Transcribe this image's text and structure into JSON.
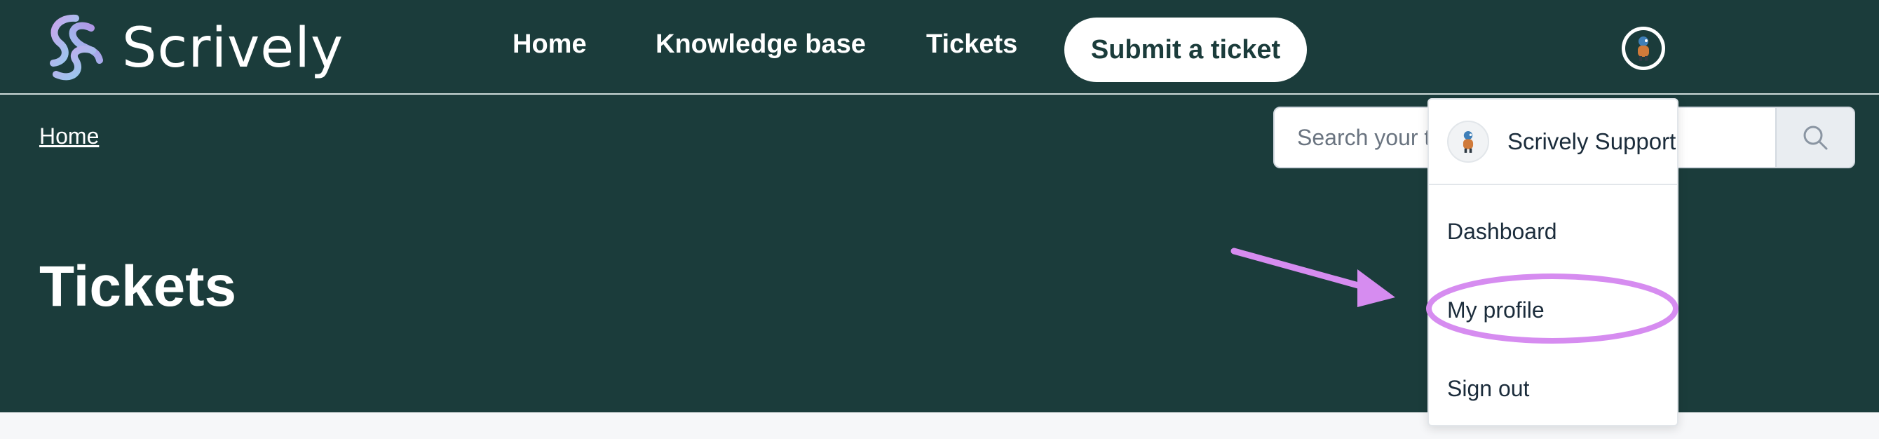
{
  "brand": {
    "name": "Scrively"
  },
  "nav": {
    "home": "Home",
    "knowledge_base": "Knowledge base",
    "tickets": "Tickets",
    "submit_ticket": "Submit a ticket"
  },
  "breadcrumb": {
    "home": "Home"
  },
  "search": {
    "placeholder": "Search your tickets"
  },
  "page": {
    "title": "Tickets"
  },
  "user_menu": {
    "user_name": "Scrively Support",
    "items": [
      "Dashboard",
      "My profile",
      "Sign out"
    ]
  },
  "icons": {
    "logo": "scrively-swirl-logo",
    "avatar": "user-avatar-icon",
    "search": "search-icon"
  },
  "colors": {
    "header_bg": "#1b3c3b",
    "annotation": "#d68cf0",
    "page_bg": "#f6f7f9"
  }
}
